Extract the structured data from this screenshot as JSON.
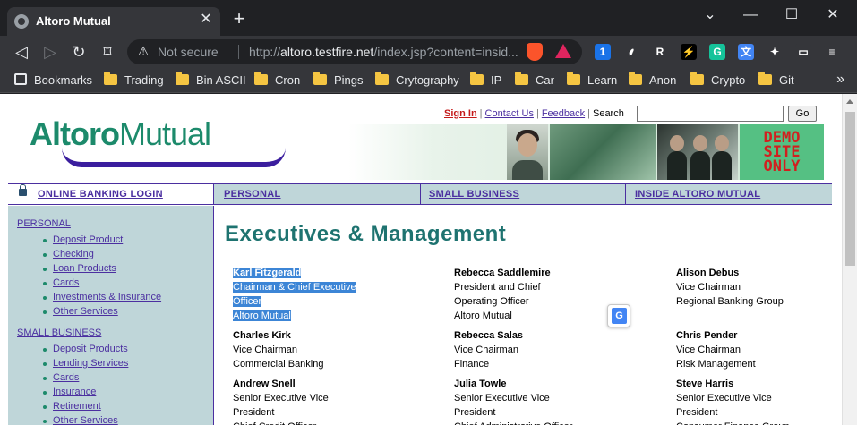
{
  "browser": {
    "tab_title": "Altoro Mutual",
    "tab_close": "✕",
    "new_tab": "+",
    "window_controls": [
      "⌄",
      "—",
      "☐",
      "✕"
    ],
    "security_label": "Not secure",
    "url_prefix": "http://",
    "url_host": "altoro.testfire.net",
    "url_path": "/index.jsp?content=insid...",
    "bookmarks": [
      "Bookmarks",
      "Trading",
      "Bin ASCII",
      "Cron",
      "Pings",
      "Crytography",
      "IP",
      "Car",
      "Learn",
      "Anon",
      "Crypto",
      "Git"
    ],
    "bookmarks_more": "»",
    "extensions": [
      {
        "name": "1password-icon",
        "glyph": "1",
        "color": "#1a73e8"
      },
      {
        "name": "robinhood-icon",
        "glyph": "⸙",
        "color": "#35363a"
      },
      {
        "name": "r-extension-icon",
        "glyph": "R",
        "color": "#35363a"
      },
      {
        "name": "lightning-icon",
        "glyph": "⚡",
        "color": "#000000"
      },
      {
        "name": "grammarly-icon",
        "glyph": "G",
        "color": "#15c39a"
      },
      {
        "name": "translate-icon",
        "glyph": "文",
        "color": "#4285f4"
      },
      {
        "name": "puzzle-icon",
        "glyph": "✦",
        "color": "#35363a"
      },
      {
        "name": "wallet-icon",
        "glyph": "▭",
        "color": "#35363a"
      },
      {
        "name": "menu-icon",
        "glyph": "≡",
        "color": "#35363a"
      }
    ]
  },
  "site": {
    "logo_bold": "Altoro",
    "logo_thin": "Mutual",
    "top_links": {
      "sign_in": "Sign In",
      "contact": "Contact Us",
      "feedback": "Feedback",
      "search_label": "Search",
      "go": "Go"
    },
    "demo_badge": [
      "DEMO",
      "SITE",
      "ONLY"
    ],
    "nav": {
      "login": "ONLINE BANKING LOGIN",
      "personal": "PERSONAL",
      "small_business": "SMALL BUSINESS",
      "inside": "INSIDE ALTORO MUTUAL"
    },
    "sidebar": {
      "personal_head": "PERSONAL",
      "personal_items": [
        "Deposit Product",
        "Checking",
        "Loan Products",
        "Cards",
        "Investments & Insurance",
        "Other Services"
      ],
      "business_head": "SMALL BUSINESS",
      "business_items": [
        "Deposit Products",
        "Lending Services",
        "Cards",
        "Insurance",
        "Retirement",
        "Other Services"
      ]
    },
    "heading": "Executives & Management",
    "executives": [
      {
        "name": "Karl Fitzgerald",
        "lines": [
          "Chairman & Chief Executive",
          "Officer",
          "Altoro Mutual"
        ],
        "highlighted": true
      },
      {
        "name": "Rebecca Saddlemire",
        "lines": [
          "President and Chief",
          "Operating Officer",
          "Altoro Mutual"
        ],
        "highlighted": false
      },
      {
        "name": "Alison Debus",
        "lines": [
          "Vice Chairman",
          "Regional Banking Group"
        ],
        "highlighted": false
      },
      {
        "name": "Charles Kirk",
        "lines": [
          "Vice Chairman",
          "Commercial Banking"
        ],
        "highlighted": false
      },
      {
        "name": "Rebecca Salas",
        "lines": [
          "Vice Chairman",
          "Finance"
        ],
        "highlighted": false
      },
      {
        "name": "Chris Pender",
        "lines": [
          "Vice Chairman",
          "Risk Management"
        ],
        "highlighted": false
      },
      {
        "name": "Andrew Snell",
        "lines": [
          "Senior Executive Vice",
          "President",
          "Chief Credit Officer"
        ],
        "highlighted": false
      },
      {
        "name": "Julia Towle",
        "lines": [
          "Senior Executive Vice",
          "President",
          "Chief Administrative Officer"
        ],
        "highlighted": false
      },
      {
        "name": "Steve Harris",
        "lines": [
          "Senior Executive Vice",
          "President",
          "Consumer Finance Group"
        ],
        "highlighted": false
      }
    ]
  }
}
